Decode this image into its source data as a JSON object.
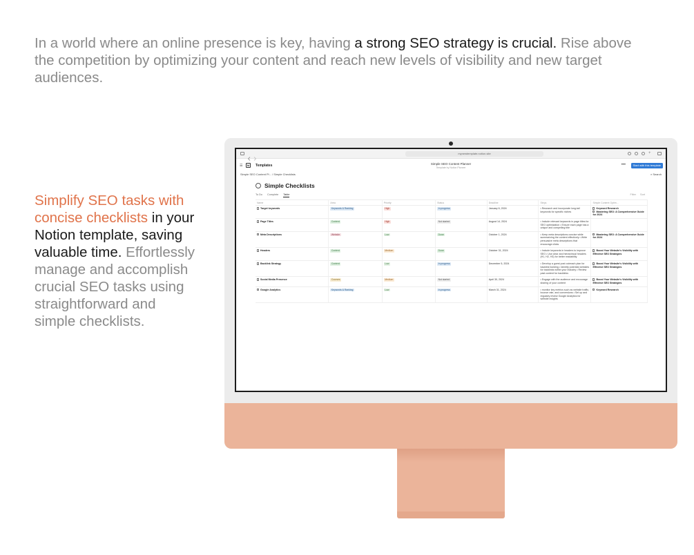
{
  "intro": {
    "part1": "In a world where an online presence is key, having ",
    "part2": "a strong SEO strategy is crucial.",
    "part3": " Rise above the competition by optimizing your content and reach new levels of visibility and new target audiences."
  },
  "side": {
    "orange": "Simplify SEO tasks with concise checklists",
    "dark": " in your Notion template, saving valuable time.",
    "grey": " Effortlessly manage and accomplish crucial SEO tasks using straightforward and simple checklists."
  },
  "browser": {
    "url": "mynewtemplate.notion.site"
  },
  "notion": {
    "templates_label": "Templates",
    "page_title": "Simple SEO Content Planner",
    "subtitle": "Template by Notion Pioneer",
    "cta": "Start with this template",
    "breadcrumb_1": "Simple SEO Content Pl...",
    "breadcrumb_2": "Simple Checklists",
    "search": "Search",
    "db_title": "Simple Checklists",
    "views": [
      "To Do",
      "Complete",
      "Table"
    ],
    "tools": [
      "Filter",
      "Sort"
    ],
    "columns": [
      "Name",
      "Area",
      "Priority",
      "Status",
      "Deadline",
      "Steps",
      "Simple Content Optim..."
    ],
    "rows": [
      {
        "name": "Target keywords",
        "area": "Keywords & Ranking",
        "priority": "High",
        "status": "In progress",
        "deadline": "January 6, 2024",
        "steps": "• Research and incorporate long-tail keywords for specific niches",
        "resources": [
          "Keyword Research",
          "Mastering SEO: A Comprehensive Guide for 2024"
        ]
      },
      {
        "name": "Page Titles",
        "area": "Content",
        "priority": "High",
        "status": "Not started",
        "deadline": "August 14, 2024",
        "steps": "• Include relevant keywords in page titles for SEO optimization • Ensure each page has a unique and compelling title",
        "resources": []
      },
      {
        "name": "Meta Descriptions",
        "area": "Website",
        "priority": "Low",
        "status": "Done",
        "deadline": "October 1, 2024",
        "steps": "• Keep meta descriptions concise while summarizing the content effectively • Write persuasive meta descriptions that encourage clicks",
        "resources": [
          "Mastering SEO: A Comprehensive Guide for 2024"
        ]
      },
      {
        "name": "Headers",
        "area": "Content",
        "priority": "Medium",
        "status": "Done",
        "deadline": "October 31, 2024",
        "steps": "• Include keywords in headers to improve SEO • Use clear and hierarchical headers (H1, H2, H3) for better readability",
        "resources": [
          "Boost Your Website's Visibility with Effective SEO Strategies"
        ]
      },
      {
        "name": "Backlink Strategy",
        "area": "Content",
        "priority": "Low",
        "status": "In progress",
        "deadline": "December 5, 2024",
        "steps": "• Develop a guest post outreach plan for backlink building • Identify potential websites for backlinks within your industry • Review past content for backlinks",
        "resources": [
          "Boost Your Website's Visibility with Effective SEO Strategies"
        ]
      },
      {
        "name": "Social Media Presence",
        "area": "Courses",
        "priority": "Medium",
        "status": "Not started",
        "deadline": "April 30, 2024",
        "steps": "• Engage with the audience and encourage sharing of your content",
        "resources": [
          "Boost Your Website's Visibility with Effective SEO Strategies"
        ]
      },
      {
        "name": "Google Analytics",
        "area": "Keywords & Ranking",
        "priority": "Low",
        "status": "In progress",
        "deadline": "March 31, 2024",
        "steps": "• monitor key metrics such as website traffic, bounce rate, and conversions • Set up and regularly review Google Analytics for website insights",
        "resources": [
          "Keyword Research"
        ]
      }
    ]
  },
  "colors": {
    "accent_orange": "#e0734a",
    "imac_chin": "#ebb49a",
    "cta_blue": "#2f7ad6"
  }
}
